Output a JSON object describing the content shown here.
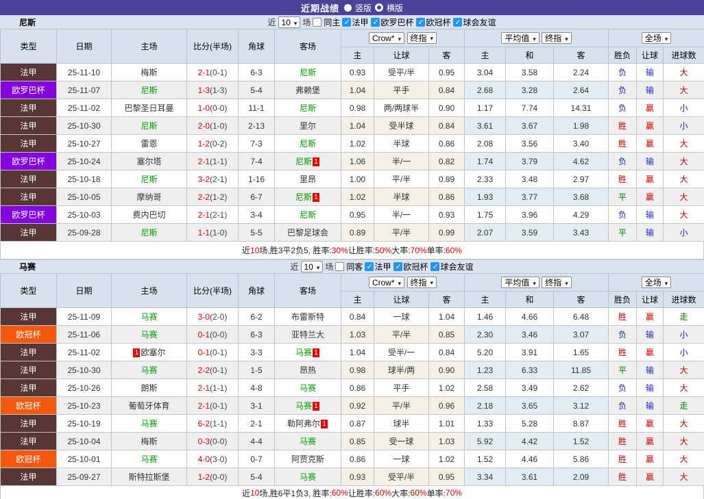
{
  "title_bar": {
    "title": "近期战绩",
    "vertical_label": "竖版",
    "horizontal_label": "横版"
  },
  "labels": {
    "near": "近",
    "matches": "场"
  },
  "headers": {
    "main": [
      "类型",
      "日期",
      "主场",
      "比分(半场)",
      "角球",
      "客场"
    ],
    "sub": [
      "主",
      "让球",
      "客",
      "主",
      "和",
      "客",
      "胜负",
      "让球",
      "进球数"
    ]
  },
  "dropdowns": [
    "Crow*",
    "终指",
    "平均值",
    "终指",
    "全场"
  ],
  "league_colors": {
    "法甲": "#593636",
    "欧罗巴杯": "#8404e0",
    "欧冠杯": "#f2590c"
  },
  "value_colors": {
    "胜": "#cc0000",
    "平": "#008800",
    "负": "#2323cc",
    "赢": "#cc0000",
    "输": "#2323cc",
    "大": "#cc0000",
    "小": "#2323cc",
    "走": "#008800"
  },
  "ui_colors": {
    "titlebar_bg": "#4c4398",
    "filter_bar_bg": "#dce3f0",
    "header_bg": "#d8e2ef",
    "row_alt_bg": "#efefef",
    "crow_col_bg": "#fdf9ef",
    "avg_col_bg": "#eaf4fb",
    "score_red": "#dd0000",
    "team_green": "#009900",
    "badge_red": "#e10000",
    "checkbox_blue": "#2196f3"
  },
  "sections": [
    {
      "team": "尼斯",
      "near_count": "10",
      "same_venue": "同主",
      "leagues": [
        "法甲",
        "欧罗巴杯",
        "欧冠杯",
        "球会友谊"
      ],
      "rows": [
        {
          "lg": "法甲",
          "date": "25-11-10",
          "home": "梅斯",
          "score": "2-1",
          "half": "(0-1)",
          "corner": "6-3",
          "away": "尼斯",
          "ag": true,
          "o1": "0.93",
          "line": "受平/半",
          "o2": "0.95",
          "a1": "3.04",
          "a2": "3.58",
          "a3": "2.24",
          "res": "负",
          "han": "输",
          "goal": "大"
        },
        {
          "lg": "欧罗巴杯",
          "date": "25-11-07",
          "home": "尼斯",
          "hg": true,
          "score": "1-3",
          "half": "(1-3)",
          "corner": "5-4",
          "away": "弗赖堡",
          "o1": "1.04",
          "line": "平手",
          "o2": "0.84",
          "a1": "2.68",
          "a2": "3.28",
          "a3": "2.64",
          "res": "负",
          "han": "输",
          "goal": "大"
        },
        {
          "lg": "法甲",
          "date": "25-11-02",
          "home": "巴黎圣日耳曼",
          "score": "1-0",
          "half": "(0-0)",
          "corner": "11-1",
          "away": "尼斯",
          "ag": true,
          "o1": "0.98",
          "line": "两/两球半",
          "o2": "0.90",
          "a1": "1.17",
          "a2": "7.74",
          "a3": "14.31",
          "res": "负",
          "han": "赢",
          "goal": "小"
        },
        {
          "lg": "法甲",
          "date": "25-10-30",
          "home": "尼斯",
          "hg": true,
          "score": "2-0",
          "half": "(1-0)",
          "corner": "2-13",
          "away": "里尔",
          "o1": "1.04",
          "line": "受半球",
          "o2": "0.84",
          "a1": "3.61",
          "a2": "3.67",
          "a3": "1.98",
          "res": "胜",
          "han": "赢",
          "goal": "小"
        },
        {
          "lg": "法甲",
          "date": "25-10-27",
          "home": "雷恩",
          "score": "1-2",
          "half": "(0-2)",
          "corner": "7-3",
          "away": "尼斯",
          "ag": true,
          "o1": "1.02",
          "line": "半球",
          "o2": "0.86",
          "a1": "2.08",
          "a2": "3.56",
          "a3": "3.40",
          "res": "胜",
          "han": "赢",
          "goal": "大"
        },
        {
          "lg": "欧罗巴杯",
          "date": "25-10-24",
          "home": "塞尔塔",
          "score": "2-1",
          "half": "(1-1)",
          "corner": "7-4",
          "away": "尼斯",
          "ag": true,
          "ab": "1",
          "o1": "1.06",
          "line": "半/一",
          "o2": "0.82",
          "a1": "1.74",
          "a2": "3.79",
          "a3": "4.62",
          "res": "负",
          "han": "输",
          "goal": "大"
        },
        {
          "lg": "法甲",
          "date": "25-10-18",
          "home": "尼斯",
          "hg": true,
          "score": "3-2",
          "half": "(2-1)",
          "corner": "1-16",
          "away": "里昂",
          "o1": "1.00",
          "line": "平/半",
          "o2": "0.89",
          "a1": "2.33",
          "a2": "3.48",
          "a3": "2.97",
          "res": "胜",
          "han": "赢",
          "goal": "大"
        },
        {
          "lg": "法甲",
          "date": "25-10-05",
          "home": "摩纳哥",
          "score": "2-2",
          "half": "(1-2)",
          "corner": "6-7",
          "away": "尼斯",
          "ag": true,
          "ab": "1",
          "o1": "1.02",
          "line": "半球",
          "o2": "0.86",
          "a1": "1.93",
          "a2": "3.77",
          "a3": "3.68",
          "res": "平",
          "han": "赢",
          "goal": "大"
        },
        {
          "lg": "欧罗巴杯",
          "date": "25-10-03",
          "home": "费内巴切",
          "score": "2-1",
          "half": "(2-1)",
          "corner": "3-4",
          "away": "尼斯",
          "ag": true,
          "o1": "0.95",
          "line": "半/一",
          "o2": "0.93",
          "a1": "1.75",
          "a2": "3.96",
          "a3": "4.29",
          "res": "负",
          "han": "输",
          "goal": "大"
        },
        {
          "lg": "法甲",
          "date": "25-09-28",
          "home": "尼斯",
          "hg": true,
          "score": "1-1",
          "half": "(1-0)",
          "corner": "5-5",
          "away": "巴黎足球会",
          "o1": "0.89",
          "line": "平/半",
          "o2": "0.99",
          "a1": "2.07",
          "a2": "3.59",
          "a3": "3.43",
          "res": "平",
          "han": "输",
          "goal": "小"
        }
      ],
      "summary": [
        {
          "t": "近"
        },
        {
          "t": "10",
          "red": true
        },
        {
          "t": "场,胜3平2负5, 胜率:"
        },
        {
          "t": "30%",
          "red": true
        },
        {
          "t": " 让胜率:"
        },
        {
          "t": "50%",
          "red": true
        },
        {
          "t": " 大率:"
        },
        {
          "t": "70%",
          "red": true
        },
        {
          "t": " 单率:"
        },
        {
          "t": "60%",
          "red": true
        }
      ]
    },
    {
      "team": "马赛",
      "near_count": "10",
      "same_venue": "同客",
      "leagues": [
        "法甲",
        "欧冠杯",
        "球会友谊"
      ],
      "rows": [
        {
          "lg": "法甲",
          "date": "25-11-09",
          "home": "马赛",
          "hg": true,
          "score": "3-0",
          "half": "(2-0)",
          "corner": "6-2",
          "away": "布雷斯特",
          "o1": "0.84",
          "line": "一球",
          "o2": "1.04",
          "a1": "1.46",
          "a2": "4.66",
          "a3": "6.48",
          "res": "胜",
          "han": "赢",
          "goal": "走"
        },
        {
          "lg": "欧冠杯",
          "date": "25-11-06",
          "home": "马赛",
          "hg": true,
          "score": "0-1",
          "half": "(0-0)",
          "corner": "6-3",
          "away": "亚特兰大",
          "o1": "1.03",
          "line": "平/半",
          "o2": "0.85",
          "a1": "2.30",
          "a2": "3.46",
          "a3": "3.07",
          "res": "负",
          "han": "输",
          "goal": "小"
        },
        {
          "lg": "法甲",
          "date": "25-11-02",
          "home": "欧塞尔",
          "hbb": "1",
          "score": "0-1",
          "half": "(0-1)",
          "corner": "3-3",
          "away": "马赛",
          "ag": true,
          "ab": "1",
          "o1": "1.04",
          "line": "受半/一",
          "o2": "0.84",
          "a1": "5.20",
          "a2": "3.91",
          "a3": "1.65",
          "res": "胜",
          "han": "赢",
          "goal": "小"
        },
        {
          "lg": "法甲",
          "date": "25-10-30",
          "home": "马赛",
          "hg": true,
          "score": "2-2",
          "half": "(0-1)",
          "corner": "1-5",
          "away": "昂热",
          "o1": "0.98",
          "line": "球半/两",
          "o2": "0.90",
          "a1": "1.23",
          "a2": "6.33",
          "a3": "11.85",
          "res": "平",
          "han": "输",
          "goal": "大"
        },
        {
          "lg": "法甲",
          "date": "25-10-26",
          "home": "朗斯",
          "score": "2-1",
          "half": "(1-1)",
          "corner": "4-8",
          "away": "马赛",
          "ag": true,
          "o1": "0.86",
          "line": "平手",
          "o2": "1.02",
          "a1": "2.58",
          "a2": "3.49",
          "a3": "2.62",
          "res": "负",
          "han": "输",
          "goal": "大"
        },
        {
          "lg": "欧冠杯",
          "date": "25-10-23",
          "home": "葡萄牙体育",
          "score": "2-1",
          "half": "(0-1)",
          "corner": "3-1",
          "away": "马赛",
          "ag": true,
          "ab": "1",
          "o1": "0.92",
          "line": "平/半",
          "o2": "0.96",
          "a1": "2.18",
          "a2": "3.65",
          "a3": "3.12",
          "res": "负",
          "han": "输",
          "goal": "走"
        },
        {
          "lg": "法甲",
          "date": "25-10-19",
          "home": "马赛",
          "hg": true,
          "score": "6-2",
          "half": "(1-1)",
          "corner": "2-1",
          "away": "勒阿弗尔",
          "ab": "1",
          "o1": "0.87",
          "line": "球半",
          "o2": "1.01",
          "a1": "1.33",
          "a2": "5.28",
          "a3": "8.87",
          "res": "胜",
          "han": "赢",
          "goal": "大"
        },
        {
          "lg": "法甲",
          "date": "25-10-04",
          "home": "梅斯",
          "score": "0-3",
          "half": "(0-0)",
          "corner": "4-4",
          "away": "马赛",
          "ag": true,
          "o1": "0.85",
          "line": "受一球",
          "o2": "1.03",
          "a1": "5.92",
          "a2": "4.42",
          "a3": "1.52",
          "res": "胜",
          "han": "赢",
          "goal": "大"
        },
        {
          "lg": "欧冠杯",
          "date": "25-10-01",
          "home": "马赛",
          "hg": true,
          "score": "4-0",
          "half": "(3-0)",
          "corner": "0-7",
          "away": "阿贾克斯",
          "o1": "0.86",
          "line": "一球",
          "o2": "1.02",
          "a1": "1.52",
          "a2": "4.46",
          "a3": "5.86",
          "res": "胜",
          "han": "赢",
          "goal": "大"
        },
        {
          "lg": "法甲",
          "date": "25-09-27",
          "home": "斯特拉斯堡",
          "score": "1-2",
          "half": "(0-0)",
          "corner": "5-4",
          "away": "马赛",
          "ag": true,
          "o1": "0.93",
          "line": "受平/半",
          "o2": "0.95",
          "a1": "3.34",
          "a2": "3.61",
          "a3": "2.09",
          "res": "胜",
          "han": "赢",
          "goal": "大"
        }
      ],
      "summary": [
        {
          "t": "近"
        },
        {
          "t": "10",
          "red": true
        },
        {
          "t": "场,胜6平1负3, 胜率:"
        },
        {
          "t": "60%",
          "red": true
        },
        {
          "t": " 让胜率:"
        },
        {
          "t": "60%",
          "red": true
        },
        {
          "t": " 大率:"
        },
        {
          "t": "60%",
          "red": true
        },
        {
          "t": " 单率:"
        },
        {
          "t": "70%",
          "red": true
        }
      ]
    }
  ]
}
